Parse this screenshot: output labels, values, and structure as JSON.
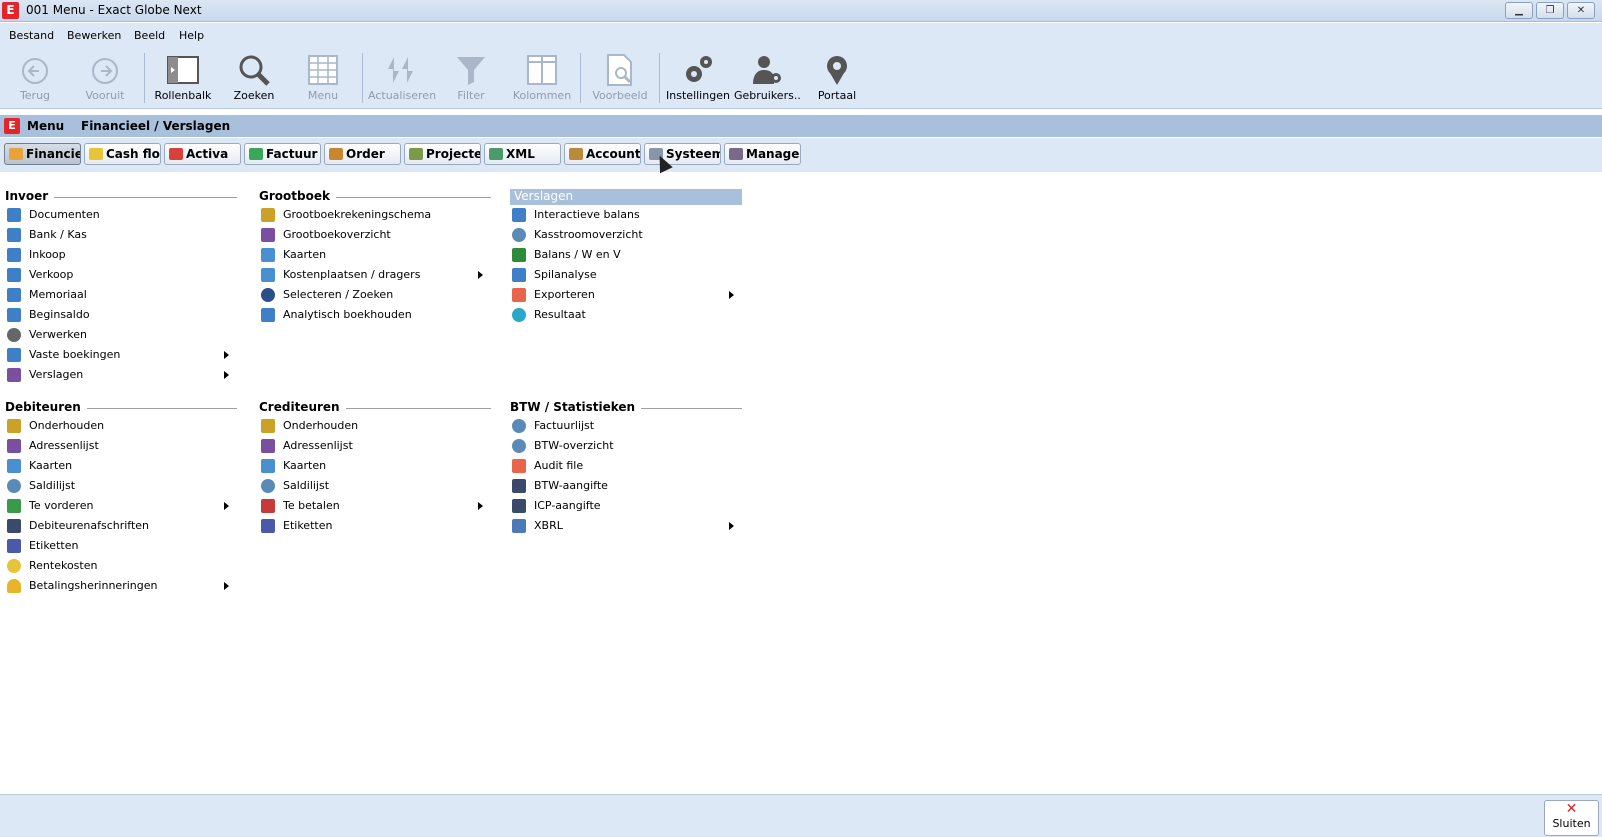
{
  "window": {
    "title": "001 Menu - Exact Globe Next",
    "logo": "E",
    "controls": [
      "minimize",
      "restore",
      "close"
    ]
  },
  "menubar": {
    "items": [
      "Bestand",
      "Bewerken",
      "Beeld",
      "Help"
    ]
  },
  "toolbar": {
    "buttons": [
      {
        "label": "Terug",
        "icon": "back-arrow-icon",
        "enabled": false
      },
      {
        "label": "Vooruit",
        "icon": "forward-arrow-icon",
        "enabled": false
      },
      {
        "label": "Rollenbalk",
        "icon": "rolebar-icon",
        "enabled": true
      },
      {
        "label": "Zoeken",
        "icon": "search-icon",
        "enabled": true
      },
      {
        "label": "Menu",
        "icon": "grid-menu-icon",
        "enabled": false
      },
      {
        "label": "Actualiseren",
        "icon": "refresh-icon",
        "enabled": false
      },
      {
        "label": "Filter",
        "icon": "filter-icon",
        "enabled": false
      },
      {
        "label": "Kolommen",
        "icon": "columns-icon",
        "enabled": false
      },
      {
        "label": "Voorbeeld",
        "icon": "preview-icon",
        "enabled": false
      },
      {
        "label": "Instellingen",
        "icon": "gears-icon",
        "enabled": true
      },
      {
        "label": "Gebruikers..",
        "icon": "users-icon",
        "enabled": true
      },
      {
        "label": "Portaal",
        "icon": "portal-icon",
        "enabled": true
      }
    ]
  },
  "breadcrumb": {
    "logo": "E",
    "menu": "Menu",
    "path": "Financieel / Verslagen"
  },
  "tabs": [
    {
      "label": "Financieel",
      "active": true,
      "color": "#e8a33a"
    },
    {
      "label": "Cash flow",
      "active": false,
      "color": "#e7c43a"
    },
    {
      "label": "Activa",
      "active": false,
      "color": "#d8413a"
    },
    {
      "label": "Factuur",
      "active": false,
      "color": "#3aa65a"
    },
    {
      "label": "Order",
      "active": false,
      "color": "#c8872e"
    },
    {
      "label": "Projecten",
      "active": false,
      "color": "#7a9a4a"
    },
    {
      "label": "XML",
      "active": false,
      "color": "#4a9a6a"
    },
    {
      "label": "Accountancy",
      "active": false,
      "color": "#b88a3a"
    },
    {
      "label": "Systeem",
      "active": false,
      "color": "#8a96a8"
    },
    {
      "label": "Management",
      "active": false,
      "color": "#7a6a8a"
    }
  ],
  "sections": {
    "invoer": {
      "title": "Invoer",
      "items": [
        {
          "label": "Documenten",
          "icon": "document-entry-icon",
          "submenu": false
        },
        {
          "label": "Bank / Kas",
          "icon": "bank-entry-icon",
          "submenu": false
        },
        {
          "label": "Inkoop",
          "icon": "purchase-entry-icon",
          "submenu": false
        },
        {
          "label": "Verkoop",
          "icon": "sales-entry-icon",
          "submenu": false
        },
        {
          "label": "Memoriaal",
          "icon": "journal-entry-icon",
          "submenu": false
        },
        {
          "label": "Beginsaldo",
          "icon": "opening-balance-icon",
          "submenu": false
        },
        {
          "label": "Verwerken",
          "icon": "gear-icon",
          "submenu": false
        },
        {
          "label": "Vaste boekingen",
          "icon": "recurring-entry-icon",
          "submenu": true
        },
        {
          "label": "Verslagen",
          "icon": "report-book-icon",
          "submenu": true
        }
      ]
    },
    "grootboek": {
      "title": "Grootboek",
      "items": [
        {
          "label": "Grootboekrekeningschema",
          "icon": "wrench-icon",
          "submenu": false
        },
        {
          "label": "Grootboekoverzicht",
          "icon": "report-book-icon",
          "submenu": false
        },
        {
          "label": "Kaarten",
          "icon": "cards-icon",
          "submenu": false
        },
        {
          "label": "Kostenplaatsen / dragers",
          "icon": "cards-icon",
          "submenu": true
        },
        {
          "label": "Selecteren / Zoeken",
          "icon": "binoculars-icon",
          "submenu": false
        },
        {
          "label": "Analytisch boekhouden",
          "icon": "analytic-entry-icon",
          "submenu": false
        }
      ]
    },
    "verslagen": {
      "title": "Verslagen",
      "highlighted": true,
      "items": [
        {
          "label": "Interactieve balans",
          "icon": "table-icon",
          "submenu": false
        },
        {
          "label": "Kasstroomoverzicht",
          "icon": "magnifier-icon",
          "submenu": false
        },
        {
          "label": "Balans / W en V",
          "icon": "excel-icon",
          "submenu": false
        },
        {
          "label": "Spilanalyse",
          "icon": "table-icon",
          "submenu": false
        },
        {
          "label": "Exporteren",
          "icon": "export-arrow-icon",
          "submenu": true
        },
        {
          "label": "Resultaat",
          "icon": "result-disc-icon",
          "submenu": false
        }
      ]
    },
    "debiteuren": {
      "title": "Debiteuren",
      "items": [
        {
          "label": "Onderhouden",
          "icon": "wrench-icon",
          "submenu": false
        },
        {
          "label": "Adressenlijst",
          "icon": "report-book-icon",
          "submenu": false
        },
        {
          "label": "Kaarten",
          "icon": "cards-icon",
          "submenu": false
        },
        {
          "label": "Saldilijst",
          "icon": "magnifier-icon",
          "submenu": false
        },
        {
          "label": "Te vorderen",
          "icon": "money-plus-icon",
          "submenu": true
        },
        {
          "label": "Debiteurenafschriften",
          "icon": "printer-icon",
          "submenu": false
        },
        {
          "label": "Etiketten",
          "icon": "label-tag-icon",
          "submenu": false
        },
        {
          "label": "Rentekosten",
          "icon": "interest-icon",
          "submenu": false
        },
        {
          "label": "Betalingsherinneringen",
          "icon": "bell-icon",
          "submenu": true
        }
      ]
    },
    "crediteuren": {
      "title": "Crediteuren",
      "items": [
        {
          "label": "Onderhouden",
          "icon": "wrench-icon",
          "submenu": false
        },
        {
          "label": "Adressenlijst",
          "icon": "report-book-icon",
          "submenu": false
        },
        {
          "label": "Kaarten",
          "icon": "cards-icon",
          "submenu": false
        },
        {
          "label": "Saldilijst",
          "icon": "magnifier-icon",
          "submenu": false
        },
        {
          "label": "Te betalen",
          "icon": "money-minus-icon",
          "submenu": true
        },
        {
          "label": "Etiketten",
          "icon": "label-tag-icon",
          "submenu": false
        }
      ]
    },
    "btw": {
      "title": "BTW / Statistieken",
      "items": [
        {
          "label": "Factuurlijst",
          "icon": "magnifier-icon",
          "submenu": false
        },
        {
          "label": "BTW-overzicht",
          "icon": "magnifier-icon",
          "submenu": false
        },
        {
          "label": "Audit file",
          "icon": "export-arrow-icon",
          "submenu": false
        },
        {
          "label": "BTW-aangifte",
          "icon": "printer-icon",
          "submenu": false
        },
        {
          "label": "ICP-aangifte",
          "icon": "printer-icon",
          "submenu": false
        },
        {
          "label": "XBRL",
          "icon": "xbrl-code-icon",
          "submenu": true
        }
      ]
    }
  },
  "footer": {
    "close_label": "Sluiten"
  }
}
